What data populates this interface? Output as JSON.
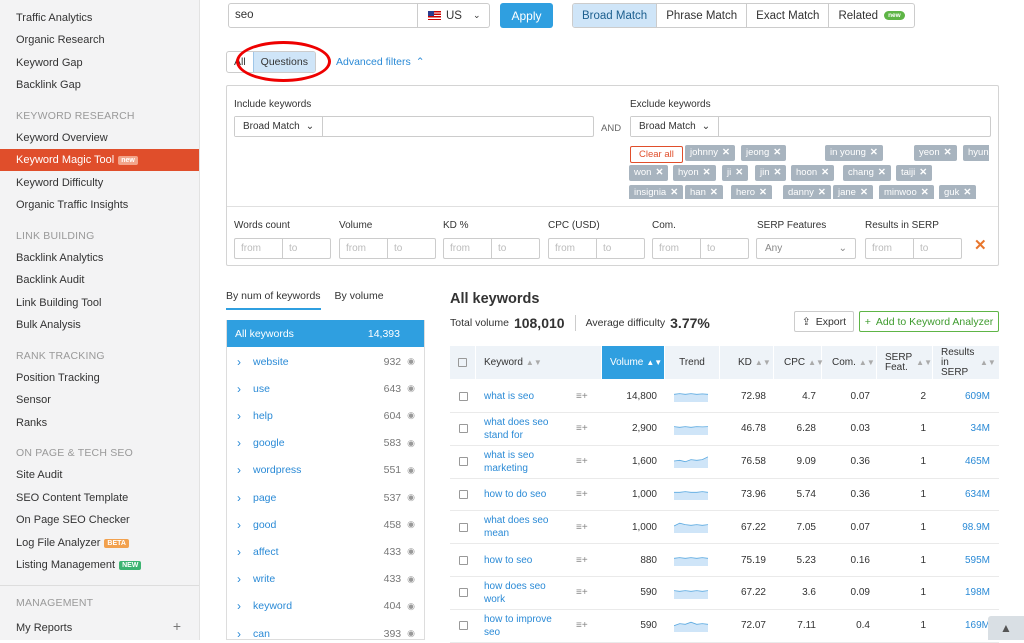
{
  "sidebar": {
    "items_top": [
      "Traffic Analytics",
      "Organic Research",
      "Keyword Gap",
      "Backlink Gap"
    ],
    "sections": [
      {
        "heading": "KEYWORD RESEARCH",
        "items": [
          "Keyword Overview",
          "Keyword Magic Tool",
          "Keyword Difficulty",
          "Organic Traffic Insights"
        ]
      },
      {
        "heading": "LINK BUILDING",
        "items": [
          "Backlink Analytics",
          "Backlink Audit",
          "Link Building Tool",
          "Bulk Analysis"
        ]
      },
      {
        "heading": "RANK TRACKING",
        "items": [
          "Position Tracking",
          "Sensor",
          "Ranks"
        ]
      },
      {
        "heading": "ON PAGE & TECH SEO",
        "items": [
          "Site Audit",
          "SEO Content Template",
          "On Page SEO Checker",
          "Log File Analyzer",
          "Listing Management"
        ]
      },
      {
        "heading": "MANAGEMENT",
        "items": [
          "My Reports"
        ]
      }
    ],
    "badge_new": "new",
    "badge_beta": "BETA",
    "badge_new2": "NEW",
    "plus": "+"
  },
  "search": {
    "query": "seo",
    "country": "US",
    "apply": "Apply"
  },
  "match_tabs": [
    "Broad Match",
    "Phrase Match",
    "Exact Match",
    "Related"
  ],
  "match_new": "new",
  "filter_tabs": {
    "all": "All",
    "questions": "Questions",
    "advanced": "Advanced filters"
  },
  "filters": {
    "include_label": "Include keywords",
    "exclude_label": "Exclude keywords",
    "include_match": "Broad Match",
    "exclude_match": "Broad Match",
    "and": "AND",
    "clear_all": "Clear all",
    "tags": [
      "johnny",
      "jeong",
      "in young",
      "yeon",
      "hyun",
      "won",
      "hyon",
      "ji",
      "jin",
      "hoon",
      "chang",
      "taiji",
      "insignia",
      "han",
      "hero",
      "danny",
      "jane",
      "minwoo",
      "guk"
    ],
    "ranges": [
      "Words count",
      "Volume",
      "KD %",
      "CPC (USD)",
      "Com.",
      "SERP Features",
      "Results in SERP"
    ],
    "from": "from",
    "to": "to",
    "any": "Any"
  },
  "groups": {
    "tab1": "By num of keywords",
    "tab2": "By volume",
    "all_label": "All keywords",
    "all_count": "14,393",
    "items": [
      {
        "name": "website",
        "count": "932"
      },
      {
        "name": "use",
        "count": "643"
      },
      {
        "name": "help",
        "count": "604"
      },
      {
        "name": "google",
        "count": "583"
      },
      {
        "name": "wordpress",
        "count": "551"
      },
      {
        "name": "page",
        "count": "537"
      },
      {
        "name": "good",
        "count": "458"
      },
      {
        "name": "affect",
        "count": "433"
      },
      {
        "name": "write",
        "count": "433"
      },
      {
        "name": "keyword",
        "count": "404"
      },
      {
        "name": "can",
        "count": "393"
      }
    ]
  },
  "keywords": {
    "title": "All keywords",
    "total_volume_label": "Total volume",
    "total_volume": "108,010",
    "avg_diff_label": "Average difficulty",
    "avg_diff": "3.77%",
    "export": "Export",
    "add_to_analyzer": "Add to Keyword Analyzer",
    "columns": [
      "Keyword",
      "Volume",
      "Trend",
      "KD",
      "CPC",
      "Com.",
      "SERP Feat.",
      "Results in SERP"
    ],
    "rows": [
      {
        "kw": "what is seo",
        "vol": "14,800",
        "kd": "72.98",
        "cpc": "4.7",
        "com": "0.07",
        "serp": "2",
        "res": "609M",
        "trend": [
          0.55,
          0.6,
          0.55,
          0.6,
          0.55,
          0.58,
          0.55
        ]
      },
      {
        "kw": "what does seo stand for",
        "vol": "2,900",
        "kd": "46.78",
        "cpc": "6.28",
        "com": "0.03",
        "serp": "1",
        "res": "34M",
        "trend": [
          0.6,
          0.55,
          0.6,
          0.55,
          0.6,
          0.58,
          0.6
        ]
      },
      {
        "kw": "what is seo marketing",
        "vol": "1,600",
        "kd": "76.58",
        "cpc": "9.09",
        "com": "0.36",
        "serp": "1",
        "res": "465M",
        "trend": [
          0.5,
          0.55,
          0.45,
          0.6,
          0.55,
          0.6,
          0.8
        ]
      },
      {
        "kw": "how to do seo",
        "vol": "1,000",
        "kd": "73.96",
        "cpc": "5.74",
        "com": "0.36",
        "serp": "1",
        "res": "634M",
        "trend": [
          0.55,
          0.55,
          0.6,
          0.55,
          0.55,
          0.6,
          0.55
        ]
      },
      {
        "kw": "what does seo mean",
        "vol": "1,000",
        "kd": "67.22",
        "cpc": "7.05",
        "com": "0.07",
        "serp": "1",
        "res": "98.9M",
        "trend": [
          0.5,
          0.7,
          0.6,
          0.55,
          0.6,
          0.55,
          0.6
        ]
      },
      {
        "kw": "how to seo",
        "vol": "880",
        "kd": "75.19",
        "cpc": "5.23",
        "com": "0.16",
        "serp": "1",
        "res": "595M",
        "trend": [
          0.55,
          0.6,
          0.55,
          0.6,
          0.55,
          0.6,
          0.55
        ]
      },
      {
        "kw": "how does seo work",
        "vol": "590",
        "kd": "67.22",
        "cpc": "3.6",
        "com": "0.09",
        "serp": "1",
        "res": "198M",
        "trend": [
          0.6,
          0.55,
          0.6,
          0.55,
          0.6,
          0.55,
          0.6
        ]
      },
      {
        "kw": "how to improve seo",
        "vol": "590",
        "kd": "72.07",
        "cpc": "7.11",
        "com": "0.4",
        "serp": "1",
        "res": "169M",
        "trend": [
          0.45,
          0.6,
          0.55,
          0.7,
          0.55,
          0.6,
          0.55
        ]
      }
    ]
  },
  "colors": {
    "accent": "#2f9fe0",
    "active_nav": "#e04e2b",
    "green": "#5eb546"
  }
}
